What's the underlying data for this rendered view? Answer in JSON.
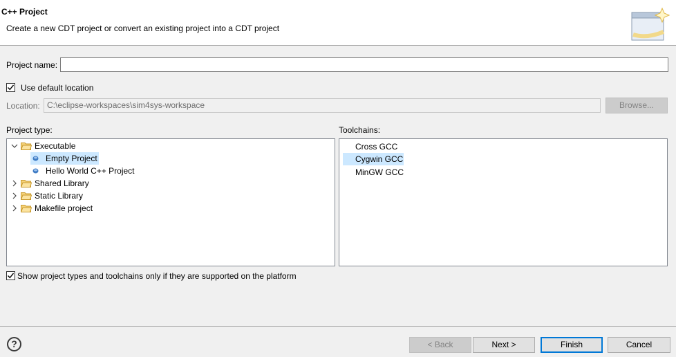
{
  "header": {
    "title": "C++ Project",
    "description": "Create a new CDT project or convert an existing project into a CDT project"
  },
  "form": {
    "project_name_label": "Project name:",
    "project_name_value": "",
    "use_default_location_label": "Use default location",
    "use_default_location_checked": true,
    "location_label": "Location:",
    "location_value": "C:\\eclipse-workspaces\\sim4sys-workspace",
    "browse_label": "Browse..."
  },
  "project_type": {
    "label": "Project type:",
    "items": [
      {
        "label": "Executable",
        "kind": "folder",
        "expanded": true
      },
      {
        "label": "Empty Project",
        "kind": "leaf",
        "selected": true
      },
      {
        "label": "Hello World C++ Project",
        "kind": "leaf"
      },
      {
        "label": "Shared Library",
        "kind": "folder",
        "expanded": false
      },
      {
        "label": "Static Library",
        "kind": "folder",
        "expanded": false
      },
      {
        "label": "Makefile project",
        "kind": "folder",
        "expanded": false
      }
    ]
  },
  "toolchains": {
    "label": "Toolchains:",
    "items": [
      {
        "label": "Cross GCC"
      },
      {
        "label": "Cygwin GCC",
        "selected": true
      },
      {
        "label": "MinGW GCC"
      }
    ]
  },
  "filter": {
    "label": "Show project types and toolchains only if they are supported on the platform",
    "checked": true
  },
  "buttons": {
    "help_glyph": "?",
    "back": "< Back",
    "next": "Next >",
    "finish": "Finish",
    "cancel": "Cancel"
  },
  "colors": {
    "selection": "#cce8ff",
    "default_button_border": "#0078d7",
    "folder": "#e8b84a"
  }
}
